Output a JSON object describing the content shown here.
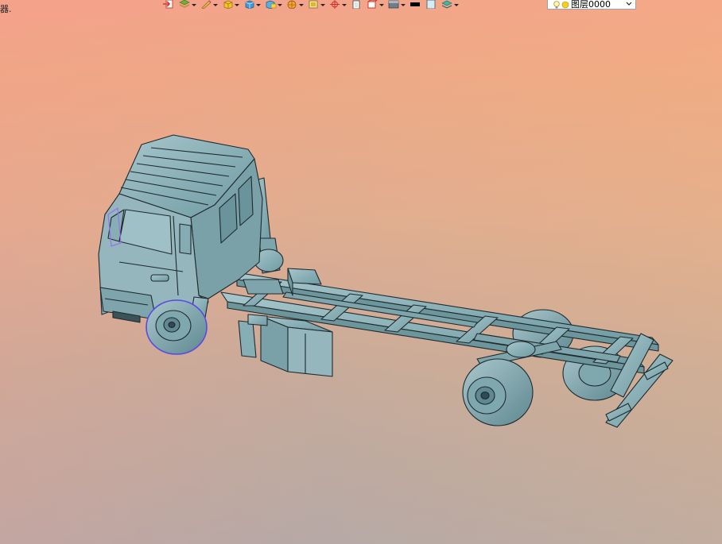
{
  "viewport": {
    "background_top": "#f3a48a",
    "background_bottom": "#b6a9a6",
    "stray_text": "器."
  },
  "toolbar": {
    "buttons": [
      {
        "name": "exit-button",
        "icon": "exit-icon",
        "dropdown": false
      },
      {
        "name": "layers-stack-button",
        "icon": "layers-icon",
        "dropdown": true
      },
      {
        "name": "pencil-button",
        "icon": "pencil-icon",
        "dropdown": true
      },
      {
        "name": "solid-box-button",
        "icon": "solid-box-icon",
        "dropdown": true
      },
      {
        "name": "shaded-box-button",
        "icon": "shaded-box-icon",
        "dropdown": true
      },
      {
        "name": "section-box-button",
        "icon": "section-box-icon",
        "dropdown": true
      },
      {
        "name": "render-sphere-button",
        "icon": "sphere-icon",
        "dropdown": true
      },
      {
        "name": "view-frame-button",
        "icon": "frame-icon",
        "dropdown": true
      },
      {
        "name": "snap-target-button",
        "icon": "crosshair-icon",
        "dropdown": true
      },
      {
        "name": "document-button",
        "icon": "document-icon",
        "dropdown": false
      },
      {
        "name": "view-cube-button",
        "icon": "view-cube-icon",
        "dropdown": true
      },
      {
        "name": "material-button",
        "icon": "material-icon",
        "dropdown": true
      },
      {
        "name": "color-black-button",
        "icon": "black-swatch-icon",
        "dropdown": false
      },
      {
        "name": "color-light-button",
        "icon": "light-swatch-icon",
        "dropdown": false
      },
      {
        "name": "layer-manager-button",
        "icon": "layer-manager-icon",
        "dropdown": true
      }
    ]
  },
  "layer_select": {
    "value": "图层0000",
    "bulb_icon": "bulb-icon",
    "sun_icon": "sun-icon"
  },
  "model": {
    "body_color": "#88aeb5",
    "edge_color": "#1e2a2e",
    "selection_color": "#5a4be8"
  }
}
